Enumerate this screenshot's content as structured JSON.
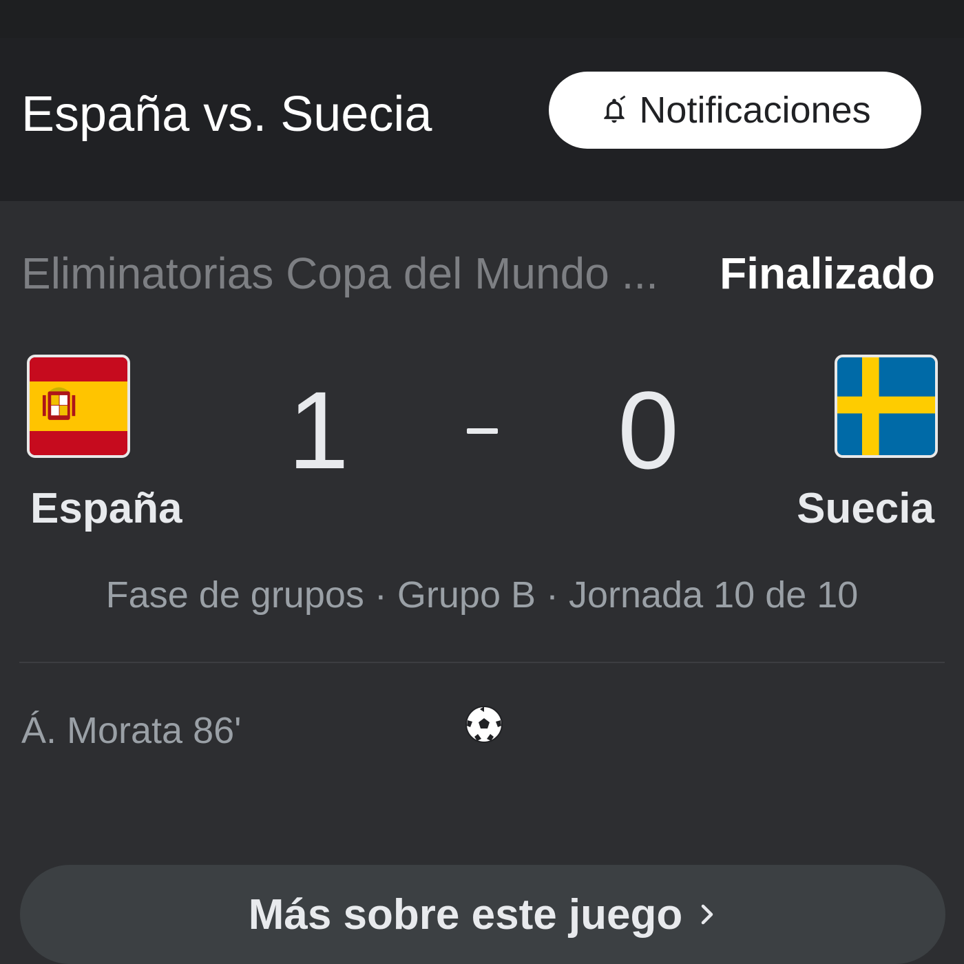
{
  "header": {
    "title": "España vs. Suecia",
    "notifications_label": "Notificaciones"
  },
  "match": {
    "competition": "Eliminatorias Copa del Mundo ...",
    "status": "Finalizado",
    "home": {
      "name": "España",
      "score": "1",
      "flag_icon": "spain-flag-icon",
      "colors": {
        "red": "#c60b1e",
        "yellow": "#ffc400"
      }
    },
    "away": {
      "name": "Suecia",
      "score": "0",
      "flag_icon": "sweden-flag-icon",
      "colors": {
        "blue": "#006aa7",
        "yellow": "#fecc00"
      }
    },
    "round_info": "Fase de grupos · Grupo B · Jornada 10 de 10",
    "goals": [
      {
        "scorer": "Á. Morata 86'",
        "icon": "soccer-ball-icon"
      }
    ]
  },
  "footer": {
    "more_label": "Más sobre este juego"
  },
  "theme": {
    "background": "#2d2e31",
    "header_background": "#202124",
    "text_primary": "#e8eaed",
    "text_secondary": "#9aa0a6",
    "button_background": "#3c4043"
  }
}
